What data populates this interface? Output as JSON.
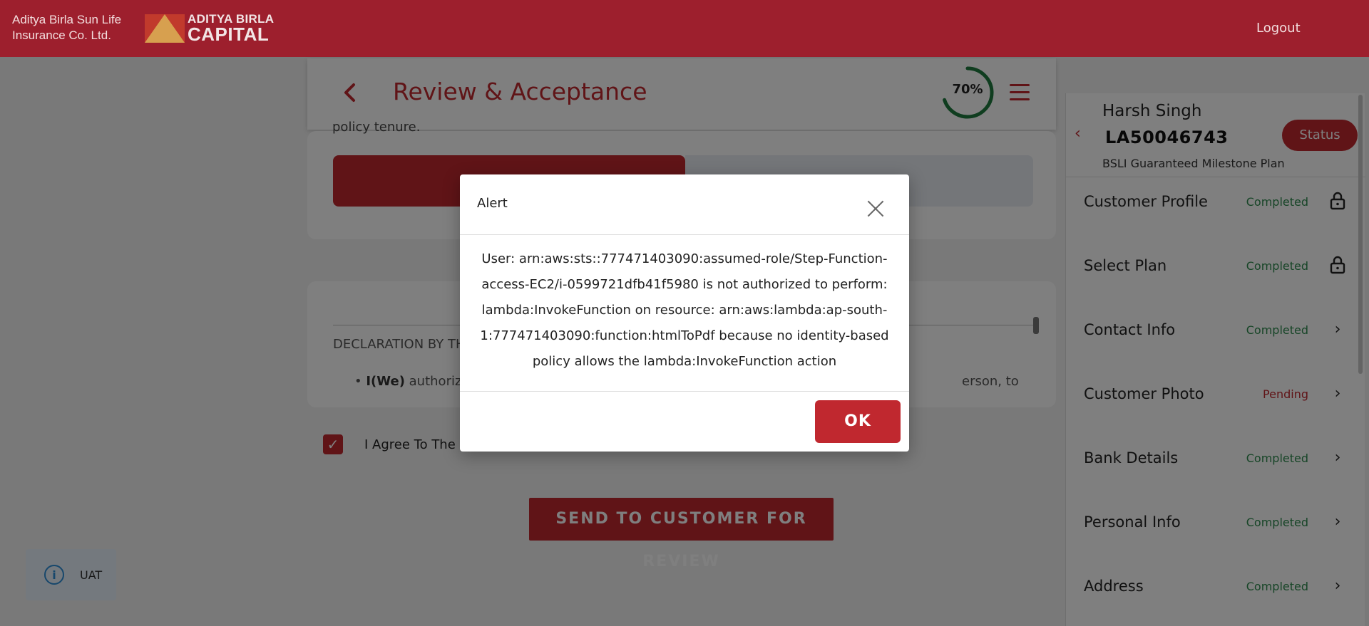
{
  "header": {
    "brand_line1": "Aditya Birla Sun Life",
    "brand_line2": "Insurance Co. Ltd.",
    "logo_line1": "ADITYA BIRLA",
    "logo_line2": "CAPITAL",
    "logout_label": "Logout"
  },
  "main": {
    "title": "Review & Acceptance",
    "progress_percent": 70,
    "progress_label": "70%",
    "card1_partial_text": "policy tenure.",
    "declaration_title": "DECLARATION BY THE",
    "declaration_item_bold": "I(We)",
    "declaration_item_text": "authoriz",
    "declaration_item_tail": "erson, to",
    "agree_label": "I Agree To The F",
    "send_button": "SEND TO CUSTOMER FOR REVIEW"
  },
  "badge": {
    "label": "UAT",
    "icon": "info-icon"
  },
  "right_panel": {
    "name": "Harsh Singh",
    "application_id": "LA50046743",
    "plan": "BSLI Guaranteed Milestone Plan",
    "status_button": "Status",
    "steps": [
      {
        "label": "Customer Profile",
        "status": "Completed",
        "icon": "lock-icon"
      },
      {
        "label": "Select Plan",
        "status": "Completed",
        "icon": "lock-icon"
      },
      {
        "label": "Contact Info",
        "status": "Completed",
        "icon": "chevron-right-icon"
      },
      {
        "label": "Customer Photo",
        "status": "Pending",
        "icon": "chevron-right-icon"
      },
      {
        "label": "Bank Details",
        "status": "Completed",
        "icon": "chevron-right-icon"
      },
      {
        "label": "Personal Info",
        "status": "Completed",
        "icon": "chevron-right-icon"
      },
      {
        "label": "Address",
        "status": "Completed",
        "icon": "chevron-right-icon"
      }
    ]
  },
  "modal": {
    "title": "Alert",
    "message": "User: arn:aws:sts::777471403090:assumed-role/Step-Function-access-EC2/i-0599721dfb41f5980 is not authorized to perform: lambda:InvokeFunction on resource: arn:aws:lambda:ap-south-1:777471403090:function:htmlToPdf because no identity-based policy allows the lambda:InvokeFunction action",
    "ok_button": "OK"
  },
  "colors": {
    "brand_red": "#c0282f",
    "header_red": "#9d1f2d",
    "completed_green": "#2e8b4e",
    "progress_green": "#1f7a3e"
  }
}
